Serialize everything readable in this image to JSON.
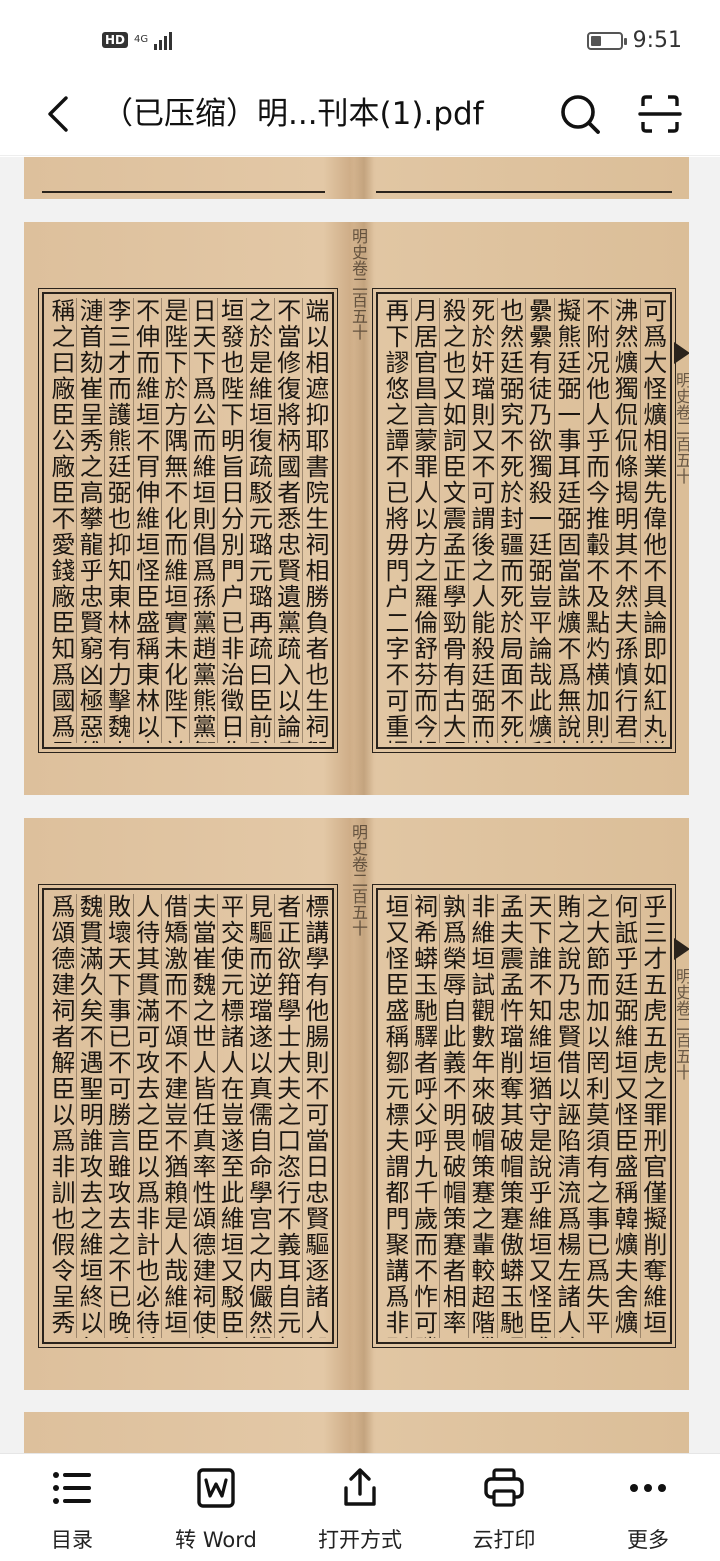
{
  "status_bar": {
    "hd_badge": "HD",
    "network": "4G",
    "time": "9:51",
    "battery_level": 0.35
  },
  "header": {
    "title": "（已压缩）明...刊本(1).pdf",
    "icons": {
      "back": "chevron-left-icon",
      "search": "search-icon",
      "scan": "scan-icon"
    }
  },
  "document": {
    "pages": [
      {
        "right_columns": [
          "可爲大怪爌相業先偉他不具論即如紅丸議起舉國",
          "沸然爌獨侃侃條揭明其不然夫孫慎行君子也爌且",
          "不附况他人乎而今推轂不及點灼横加則徒以其票",
          "擬熊廷弼一事耳廷弼固當誅爌不爲無說封疆失事",
          "纍纍有徒乃欲獨殺一廷弼豈平論哉此爌所以閣筆",
          "也然廷弼究不死於封疆而死於局面不死於法吏而",
          "死於奸璫則又不可謂後之人能殺廷弼而爌獨不能",
          "殺之也又如詞臣文震孟正學勁骨有古大臣之品三",
          "月居官昌言蒙罪人以方之羅倫舒芬而今起用之旨",
          "再下謬悠之譚不已將毋門户二字不可重提耶用吏"
        ],
        "left_columns": [
          "端以相遮抑耶書院生祠相勝負者也生祠毀書院豈",
          "不當修復將柄國者悉忠賢遺黨疏入以論奏不當責",
          "之於是維垣復疏駁元璐元璐再疏曰臣前疏原爲維",
          "垣發也陛下明旨日分別門户已非治徵日化異爲同",
          "日天下爲公而維垣則倡爲孫黨趙黨熊黨鄒黨之說",
          "是陛下於方隅無不化而維垣實未化陛下於正氣無",
          "不伸而維垣不肎伸維垣怪臣盛稱東林以東林嘗推",
          "李三才而護熊廷弼也抑知東林有力擊魏忠賢之楊",
          "漣首劾崔呈秀之高攀龍乎忠賢窮凶極惡維垣猶奪",
          "稱之曰廠臣公廠臣不愛錢廠臣知爲國爲民而何責"
        ],
        "gutter_right": "明史卷二百五十",
        "gutter_left": "明史卷二百五十"
      },
      {
        "right_columns": [
          "乎三才五虎五虎之罪刑官僅擬削奪維垣不駁正又",
          "何詆乎廷弼維垣又怪臣盛稱韓爌夫舍爌昭然忤璫",
          "之大節而加以罔利莫須有之事已爲失平至廷弼行",
          "賄之說乃忠賢借以誣陷清流爲楊左諸人追贓地耳",
          "天下誰不知維垣猶守是說乎維垣又怪臣盛稱文震",
          "孟夫震孟忤璫削奪其破帽策蹇傲蟒玉馳驛語何可",
          "非維垣試觀數年來破帽策蹇之輩較超階躐級之儔",
          "孰爲榮辱自此義不明畏破帽策蹇者相率而頌德建",
          "祠希蟒玉馳驛者呼父呼九千歲而不怍可勝歎哉維",
          "垣又怪臣盛稱鄒元標夫謂都門聚講爲非則可謂元"
        ],
        "left_columns": [
          "標講學有他腸則不可當日忠賢驅逐諸人毀廢書院",
          "者正欲箝學士大夫之口恣行不義耳自元標以僞學",
          "見驅而逆璫遂以真儒自命學宫之内儼然揖先聖爲",
          "平交使元標諸人在豈遂至此維垣又駁臣假借矯激",
          "夫當崔魏之世人皆任真率性頌德建祠使有一人假",
          "借矯激而不頌不建豈不猶賴是人哉維垣以爲真小",
          "人待其貫滿可攻去之臣以爲非計也必待其貫滿其",
          "敗壞天下事已不可勝言雖攻去之不已晚乎即如崔",
          "魏貫滿久矣不遇聖明誰攻去之維垣終以無可奈何",
          "爲頌德建祠者解臣以爲非訓也假令呈秀一人舞蹈"
        ],
        "gutter_right": "明史卷二百五十",
        "gutter_left": "明史卷二百五十"
      }
    ]
  },
  "toolbar": {
    "items": [
      {
        "label": "目录",
        "icon": "list-icon"
      },
      {
        "label": "转 Word",
        "icon": "word-icon"
      },
      {
        "label": "打开方式",
        "icon": "share-icon"
      },
      {
        "label": "云打印",
        "icon": "printer-icon"
      },
      {
        "label": "更多",
        "icon": "more-dots-icon"
      }
    ]
  }
}
